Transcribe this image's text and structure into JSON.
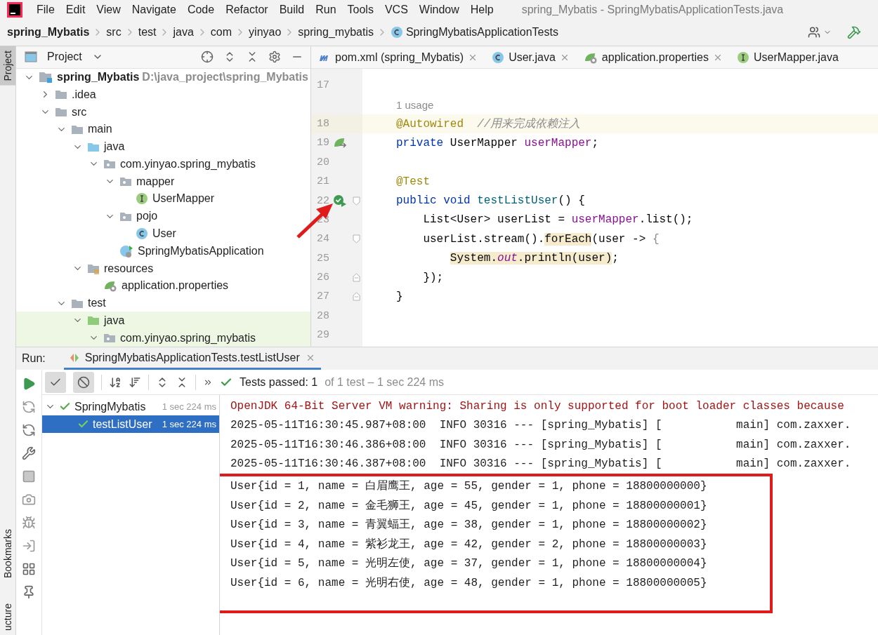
{
  "menu_bar": {
    "items": [
      "File",
      "Edit",
      "View",
      "Navigate",
      "Code",
      "Refactor",
      "Build",
      "Run",
      "Tools",
      "VCS",
      "Window",
      "Help"
    ],
    "title": "spring_Mybatis - SpringMybatisApplicationTests.java"
  },
  "breadcrumb": [
    {
      "label": "spring_Mybatis",
      "kind": "project"
    },
    {
      "label": "src",
      "kind": "folder"
    },
    {
      "label": "test",
      "kind": "folder"
    },
    {
      "label": "java",
      "kind": "folder"
    },
    {
      "label": "com",
      "kind": "folder"
    },
    {
      "label": "yinyao",
      "kind": "folder"
    },
    {
      "label": "spring_mybatis",
      "kind": "folder"
    },
    {
      "label": "SpringMybatisApplicationTests",
      "kind": "class"
    }
  ],
  "side_strip": {
    "top": "Project",
    "bottom": [
      "Bookmarks",
      "ucture"
    ]
  },
  "project_panel": {
    "title": "Project",
    "tree": [
      {
        "label": "spring_Mybatis",
        "path": "D:\\java_project\\spring_Mybatis",
        "kind": "module",
        "expanded": true,
        "highlighted": false,
        "children": [
          {
            "label": ".idea",
            "kind": "folder",
            "expanded": false,
            "highlighted": false
          },
          {
            "label": "src",
            "kind": "folder",
            "expanded": true,
            "highlighted": false,
            "children": [
              {
                "label": "main",
                "kind": "folder",
                "expanded": true,
                "highlighted": false,
                "children": [
                  {
                    "label": "java",
                    "kind": "source",
                    "expanded": true,
                    "highlighted": false,
                    "children": [
                      {
                        "label": "com.yinyao.spring_mybatis",
                        "kind": "package",
                        "expanded": true,
                        "highlighted": false,
                        "children": [
                          {
                            "label": "mapper",
                            "kind": "package",
                            "expanded": true,
                            "highlighted": false,
                            "children": [
                              {
                                "label": "UserMapper",
                                "kind": "interface",
                                "highlighted": false
                              }
                            ]
                          },
                          {
                            "label": "pojo",
                            "kind": "package",
                            "expanded": true,
                            "highlighted": false,
                            "children": [
                              {
                                "label": "User",
                                "kind": "class",
                                "highlighted": false
                              }
                            ]
                          },
                          {
                            "label": "SpringMybatisApplication",
                            "kind": "spring-class",
                            "highlighted": false
                          }
                        ]
                      }
                    ]
                  },
                  {
                    "label": "resources",
                    "kind": "resources",
                    "expanded": true,
                    "highlighted": false,
                    "children": [
                      {
                        "label": "application.properties",
                        "kind": "properties",
                        "highlighted": false
                      }
                    ]
                  }
                ]
              },
              {
                "label": "test",
                "kind": "folder",
                "expanded": true,
                "highlighted": false,
                "children": [
                  {
                    "label": "java",
                    "kind": "test-source",
                    "expanded": true,
                    "highlighted": true,
                    "children": [
                      {
                        "label": "com.yinyao.spring_mybatis",
                        "kind": "package",
                        "expanded": true,
                        "highlighted": true
                      }
                    ]
                  }
                ]
              }
            ]
          }
        ]
      }
    ]
  },
  "editor": {
    "tabs": [
      {
        "label": "pom.xml (spring_Mybatis)",
        "kind": "maven",
        "closable": true
      },
      {
        "label": "User.java",
        "kind": "class",
        "closable": true
      },
      {
        "label": "application.properties",
        "kind": "properties",
        "closable": true
      },
      {
        "label": "UserMapper.java",
        "kind": "interface",
        "closable": false
      }
    ],
    "lines": [
      {
        "number": "17",
        "highlighted": false
      },
      {
        "number": "18",
        "highlighted": true,
        "hint": "1 usage",
        "tokens": [
          {
            "text": "@Autowired",
            "kind": "annotation",
            "highlighted": false
          },
          {
            "text": "  //用来完成依赖注入",
            "kind": "comment",
            "highlighted": false
          }
        ]
      },
      {
        "number": "19",
        "highlighted": false,
        "gutter": {
          "kind": "bean"
        },
        "tokens": [
          {
            "text": "private",
            "kind": "keyword",
            "highlighted": false
          },
          {
            "text": " UserMapper ",
            "kind": "plain",
            "highlighted": false
          },
          {
            "text": "userMapper",
            "kind": "field",
            "highlighted": false
          },
          {
            "text": ";",
            "kind": "plain",
            "highlighted": false
          }
        ]
      },
      {
        "number": "20",
        "highlighted": false
      },
      {
        "number": "21",
        "highlighted": false,
        "tokens": [
          {
            "text": "@Test",
            "kind": "annotation",
            "highlighted": false
          }
        ]
      },
      {
        "number": "22",
        "highlighted": false,
        "gutter": {
          "kind": "run"
        },
        "fold": {
          "kind": "start"
        },
        "tokens": [
          {
            "text": "public void ",
            "kind": "keyword",
            "highlighted": false
          },
          {
            "text": "testListUser",
            "kind": "method",
            "highlighted": false
          },
          {
            "text": "() {",
            "kind": "plain",
            "highlighted": false
          }
        ]
      },
      {
        "number": "23",
        "highlighted": false,
        "tokens": [
          {
            "text": "    List<User> userList = ",
            "kind": "plain",
            "highlighted": false
          },
          {
            "text": "userMapper",
            "kind": "field",
            "highlighted": false
          },
          {
            "text": ".list();",
            "kind": "plain",
            "highlighted": false
          }
        ]
      },
      {
        "number": "24",
        "highlighted": false,
        "fold": {
          "kind": "start"
        },
        "tokens": [
          {
            "text": "    userList.stream().",
            "kind": "plain",
            "highlighted": false
          },
          {
            "text": "forEach",
            "kind": "plain",
            "highlighted": true
          },
          {
            "text": "(user -> ",
            "kind": "plain",
            "highlighted": false
          },
          {
            "text": "{",
            "kind": "dim",
            "highlighted": false
          }
        ]
      },
      {
        "number": "25",
        "highlighted": false,
        "tokens": [
          {
            "text": "        System.",
            "kind": "plain",
            "highlighted": true
          },
          {
            "text": "out",
            "kind": "static",
            "highlighted": true
          },
          {
            "text": ".println(user)",
            "kind": "plain",
            "highlighted": true
          },
          {
            "text": ";",
            "kind": "plain",
            "highlighted": false
          }
        ]
      },
      {
        "number": "26",
        "highlighted": false,
        "fold": {
          "kind": "end"
        },
        "tokens": [
          {
            "text": "    });",
            "kind": "plain",
            "highlighted": false
          }
        ]
      },
      {
        "number": "27",
        "highlighted": false,
        "fold": {
          "kind": "end"
        },
        "tokens": [
          {
            "text": "}",
            "kind": "plain",
            "highlighted": false
          }
        ]
      },
      {
        "number": "28",
        "highlighted": false
      },
      {
        "number": "29",
        "highlighted": false
      }
    ]
  },
  "run_panel": {
    "label": "Run:",
    "tab": "SpringMybatisApplicationTests.testListUser",
    "status": {
      "label": "Tests passed: 1",
      "detail": "of 1 test – 1 sec 224 ms"
    },
    "tests": [
      {
        "name": "SpringMybatis",
        "duration": "1 sec 224 ms",
        "expanded": true,
        "selected": false,
        "children": [
          {
            "name": "testListUser",
            "duration": "1 sec 224 ms",
            "selected": true
          }
        ]
      }
    ],
    "console": [
      {
        "text": "OpenJDK 64-Bit Server VM warning: Sharing is only supported for boot loader classes because",
        "kind": "warning"
      },
      {
        "text": "2025-05-11T16:30:45.987+08:00  INFO 30316 --- [spring_Mybatis] [           main] com.zaxxer.",
        "kind": "log"
      },
      {
        "text": "2025-05-11T16:30:46.386+08:00  INFO 30316 --- [spring_Mybatis] [           main] com.zaxxer.",
        "kind": "log"
      },
      {
        "text": "2025-05-11T16:30:46.387+08:00  INFO 30316 --- [spring_Mybatis] [           main] com.zaxxer.",
        "kind": "log"
      },
      {
        "text": "User{id = 1, name = 白眉鹰王, age = 55, gender = 1, phone = 18800000000}",
        "kind": "output"
      },
      {
        "text": "User{id = 2, name = 金毛狮王, age = 45, gender = 1, phone = 18800000001}",
        "kind": "output"
      },
      {
        "text": "User{id = 3, name = 青翼蝠王, age = 38, gender = 1, phone = 18800000002}",
        "kind": "output"
      },
      {
        "text": "User{id = 4, name = 紫衫龙王, age = 42, gender = 2, phone = 18800000003}",
        "kind": "output"
      },
      {
        "text": "User{id = 5, name = 光明左使, age = 37, gender = 1, phone = 18800000004}",
        "kind": "output"
      },
      {
        "text": "User{id = 6, name = 光明右使, age = 48, gender = 1, phone = 18800000005}",
        "kind": "output"
      }
    ]
  }
}
